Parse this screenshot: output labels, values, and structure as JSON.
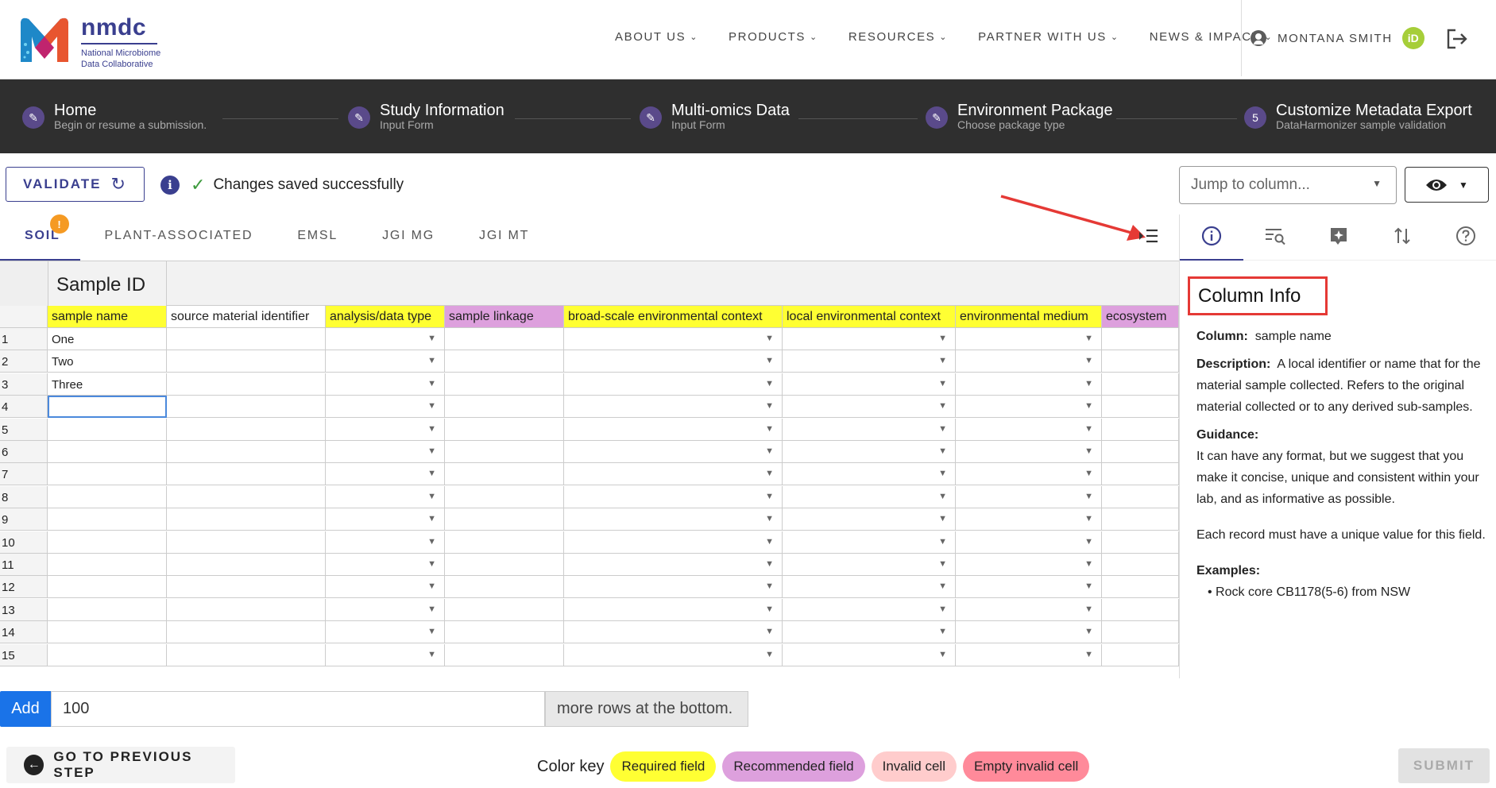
{
  "brand": {
    "name": "nmdc",
    "subtitle_line1": "National Microbiome",
    "subtitle_line2": "Data Collaborative"
  },
  "nav": {
    "items": [
      "ABOUT US",
      "PRODUCTS",
      "RESOURCES",
      "PARTNER WITH US",
      "NEWS & IMPACT"
    ],
    "user_name": "MONTANA SMITH",
    "orcid_label": "iD"
  },
  "stepper": {
    "steps": [
      {
        "title": "Home",
        "subtitle": "Begin or resume a submission."
      },
      {
        "title": "Study Information",
        "subtitle": "Input Form"
      },
      {
        "title": "Multi-omics Data",
        "subtitle": "Input Form"
      },
      {
        "title": "Environment Package",
        "subtitle": "Choose package type"
      },
      {
        "title": "Customize Metadata Export",
        "subtitle": "DataHarmonizer sample validation",
        "number": "5"
      }
    ]
  },
  "toolbar": {
    "validate_label": "VALIDATE",
    "saved_message": "Changes saved successfully",
    "jump_placeholder": "Jump to column..."
  },
  "tabs": {
    "items": [
      "SOIL",
      "PLANT-ASSOCIATED",
      "EMSL",
      "JGI MG",
      "JGI MT"
    ],
    "active": "SOIL",
    "badge": "!"
  },
  "grid": {
    "section_label": "Sample ID",
    "columns": [
      {
        "label": "sample name",
        "kind": "required"
      },
      {
        "label": "source material identifier",
        "kind": "plain"
      },
      {
        "label": "analysis/data type",
        "kind": "required"
      },
      {
        "label": "sample linkage",
        "kind": "recommended"
      },
      {
        "label": "broad-scale environmental context",
        "kind": "required"
      },
      {
        "label": "local environmental context",
        "kind": "required"
      },
      {
        "label": "environmental medium",
        "kind": "required"
      },
      {
        "label": "ecosystem",
        "kind": "recommended"
      }
    ],
    "row_numbers": [
      "1",
      "2",
      "3",
      "4",
      "5",
      "6",
      "7",
      "8",
      "9",
      "10",
      "11",
      "12",
      "13",
      "14",
      "15"
    ],
    "sample_names": [
      "One",
      "Two",
      "Three"
    ]
  },
  "panel": {
    "title": "Column Info",
    "column_label": "Column:",
    "column_value": "sample name",
    "description_label": "Description:",
    "description_text": "A local identifier or name that for the material sample collected. Refers to the original material collected or to any derived sub-samples.",
    "guidance_label": "Guidance:",
    "guidance_text": "It can have any format, but we suggest that you make it concise, unique and consistent within your lab, and as informative as possible.",
    "unique_note": "Each record must have a unique value for this field.",
    "examples_label": "Examples:",
    "examples": [
      "Rock core CB1178(5-6) from NSW"
    ]
  },
  "add_rows": {
    "button_label": "Add",
    "count": "100",
    "suffix": "more rows at the bottom."
  },
  "footer": {
    "prev_label": "GO TO PREVIOUS STEP",
    "color_key_label": "Color key",
    "chips": [
      "Required field",
      "Recommended field",
      "Invalid cell",
      "Empty invalid cell"
    ],
    "submit_label": "SUBMIT"
  },
  "colors": {
    "brand": "#3a3f8f",
    "required": "#ffff33",
    "recommended": "#dda0dd",
    "invalid": "#ffcccc",
    "empty_invalid": "#ff8a9a",
    "add_button": "#1a73e8",
    "badge": "#f59a23",
    "annotation_red": "#e53935"
  },
  "icons": {
    "user": "account-circle-icon",
    "logout": "logout-icon",
    "edit": "pencil-icon",
    "refresh": "refresh-icon",
    "info": "info-icon",
    "check": "check-icon",
    "eye": "eye-icon",
    "collapse": "format-indent-icon",
    "panel_info": "info-outline-icon",
    "panel_search": "search-list-icon",
    "panel_ai": "sparkle-icon",
    "panel_sort": "swap-vertical-icon",
    "panel_help": "help-icon"
  }
}
